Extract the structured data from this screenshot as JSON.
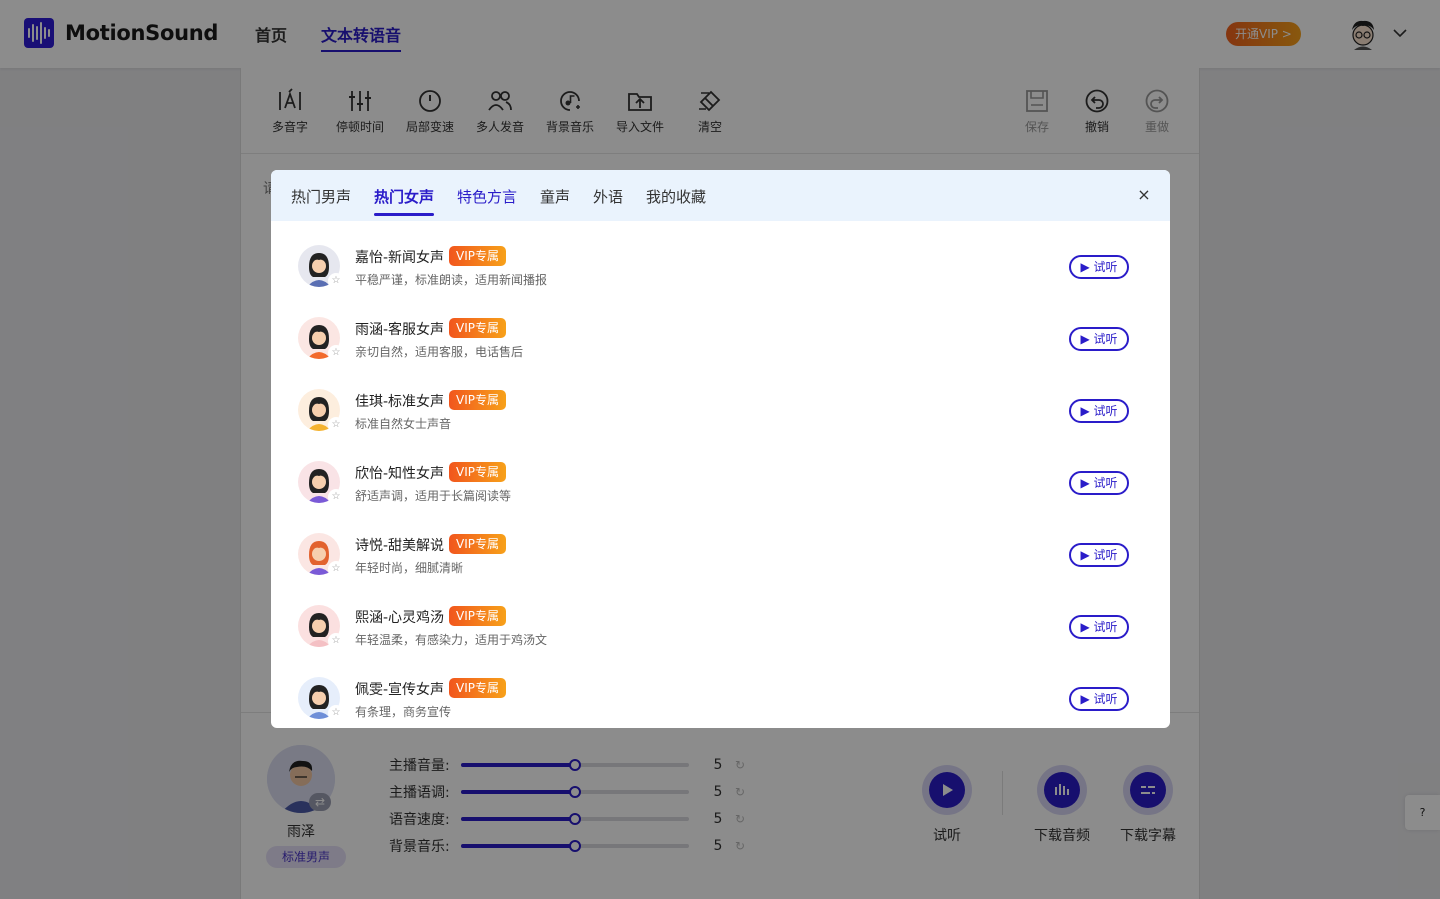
{
  "app": {
    "name": "MotionSound"
  },
  "nav": [
    {
      "label": "首页"
    },
    {
      "label": "文本转语音"
    }
  ],
  "header": {
    "vip_label": "开通VIP >"
  },
  "toolbar": {
    "tools": [
      {
        "label": "多音字",
        "icon": "polyphone-icon"
      },
      {
        "label": "停顿时间",
        "icon": "pause-time-icon"
      },
      {
        "label": "局部变速",
        "icon": "speed-icon"
      },
      {
        "label": "多人发音",
        "icon": "multi-speaker-icon"
      },
      {
        "label": "背景音乐",
        "icon": "music-icon"
      },
      {
        "label": "导入文件",
        "icon": "import-icon"
      },
      {
        "label": "清空",
        "icon": "clear-icon"
      }
    ],
    "save_label": "保存",
    "undo_label": "撤销",
    "redo_label": "重做"
  },
  "editor": {
    "placeholder_fragment": "请"
  },
  "anchor": {
    "name": "雨泽",
    "tag": "标准男声"
  },
  "sliders": [
    {
      "label": "主播音量:",
      "value": "5",
      "fraction": 0.5
    },
    {
      "label": "主播语调:",
      "value": "5",
      "fraction": 0.5
    },
    {
      "label": "语音速度:",
      "value": "5",
      "fraction": 0.5
    },
    {
      "label": "背景音乐:",
      "value": "5",
      "fraction": 0.5
    }
  ],
  "actions": [
    {
      "label": "试听"
    },
    {
      "label": "下载音频"
    },
    {
      "label": "下载字幕"
    }
  ],
  "help": {
    "label": "?"
  },
  "modal": {
    "tabs": [
      {
        "label": "热门男声"
      },
      {
        "label": "热门女声"
      },
      {
        "label": "特色方言"
      },
      {
        "label": "童声"
      },
      {
        "label": "外语"
      },
      {
        "label": "我的收藏"
      }
    ],
    "close_label": "×",
    "voices": [
      {
        "name": "嘉怡-新闻女声",
        "tag": "VIP专属",
        "desc": "平稳严谨，标准朗读，适用新闻播报",
        "try": "试听",
        "bg": "#e6e7ef",
        "shirt": "#5a6fb3"
      },
      {
        "name": "雨涵-客服女声",
        "tag": "VIP专属",
        "desc": "亲切自然，适用客服，电话售后",
        "try": "试听",
        "bg": "#fbe6e3",
        "shirt": "#f26a2c"
      },
      {
        "name": "佳琪-标准女声",
        "tag": "VIP专属",
        "desc": "标准自然女士声音",
        "try": "试听",
        "bg": "#fdeede",
        "shirt": "#f4b22f"
      },
      {
        "name": "欣怡-知性女声",
        "tag": "VIP专属",
        "desc": "舒适声调，适用于长篇阅读等",
        "try": "试听",
        "bg": "#f9e3e6",
        "shirt": "#7a5ad7"
      },
      {
        "name": "诗悦-甜美解说",
        "tag": "VIP专属",
        "desc": "年轻时尚，细腻清晰",
        "try": "试听",
        "bg": "#fbe6e3",
        "shirt": "#7a5ad7"
      },
      {
        "name": "熙涵-心灵鸡汤",
        "tag": "VIP专属",
        "desc": "年轻温柔，有感染力，适用于鸡汤文",
        "try": "试听",
        "bg": "#fbe0e0",
        "shirt": "#f4c0c4"
      },
      {
        "name": "佩雯-宣传女声",
        "tag": "VIP专属",
        "desc": "有条理，商务宣传",
        "try": "试听",
        "bg": "#e6eefb",
        "shirt": "#6f8fd8"
      }
    ]
  },
  "colors": {
    "accent": "#2a1cc9",
    "vip_gradient_start": "#f1561d",
    "vip_gradient_end": "#f7a11a",
    "modal_tab_bg": "#eaf3fd"
  }
}
